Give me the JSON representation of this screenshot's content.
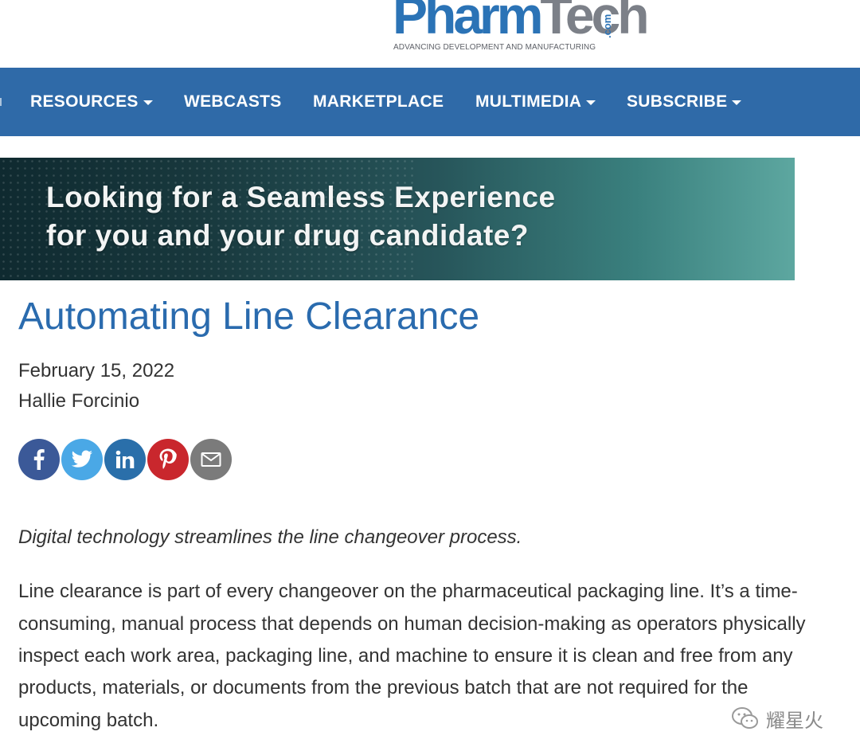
{
  "header": {
    "logo_part1": "Pharm",
    "logo_part2": "Tech",
    "logo_suffix": ".com",
    "tagline": "ADVANCING DEVELOPMENT AND MANUFACTURING"
  },
  "nav": {
    "items": [
      {
        "label": "RESOURCES",
        "has_dropdown": true
      },
      {
        "label": "WEBCASTS",
        "has_dropdown": false
      },
      {
        "label": "MARKETPLACE",
        "has_dropdown": false
      },
      {
        "label": "MULTIMEDIA",
        "has_dropdown": true
      },
      {
        "label": "SUBSCRIBE",
        "has_dropdown": true
      }
    ],
    "color": "#2f6aa8"
  },
  "banner": {
    "line1": "Looking for a Seamless Experience",
    "line2": "for you and your drug candidate?"
  },
  "article": {
    "title": "Automating Line Clearance",
    "date": "February 15, 2022",
    "author": "Hallie Forcinio",
    "share_icons": [
      "facebook-icon",
      "twitter-icon",
      "linkedin-icon",
      "pinterest-icon",
      "email-icon"
    ],
    "lede": "Digital technology streamlines the line changeover process.",
    "body_lines": [
      "Line clearance is part of every changeover on the pharmaceutical packaging line. It’s a time-",
      "consuming, manual process that depends on human decision-making as operators physically",
      "inspect each work area, packaging line, and machine to ensure it is clean and free from any",
      "products, materials, or documents from the previous batch that are not required for the",
      "upcoming batch."
    ]
  },
  "watermark": {
    "text": "耀星火"
  },
  "colors": {
    "brand_blue": "#2b73b6",
    "title_blue": "#2a6bae",
    "facebook": "#3b5998",
    "twitter": "#4aa8e6",
    "linkedin": "#2a6faa",
    "pinterest": "#c9272d",
    "email": "#7b7b7b"
  }
}
